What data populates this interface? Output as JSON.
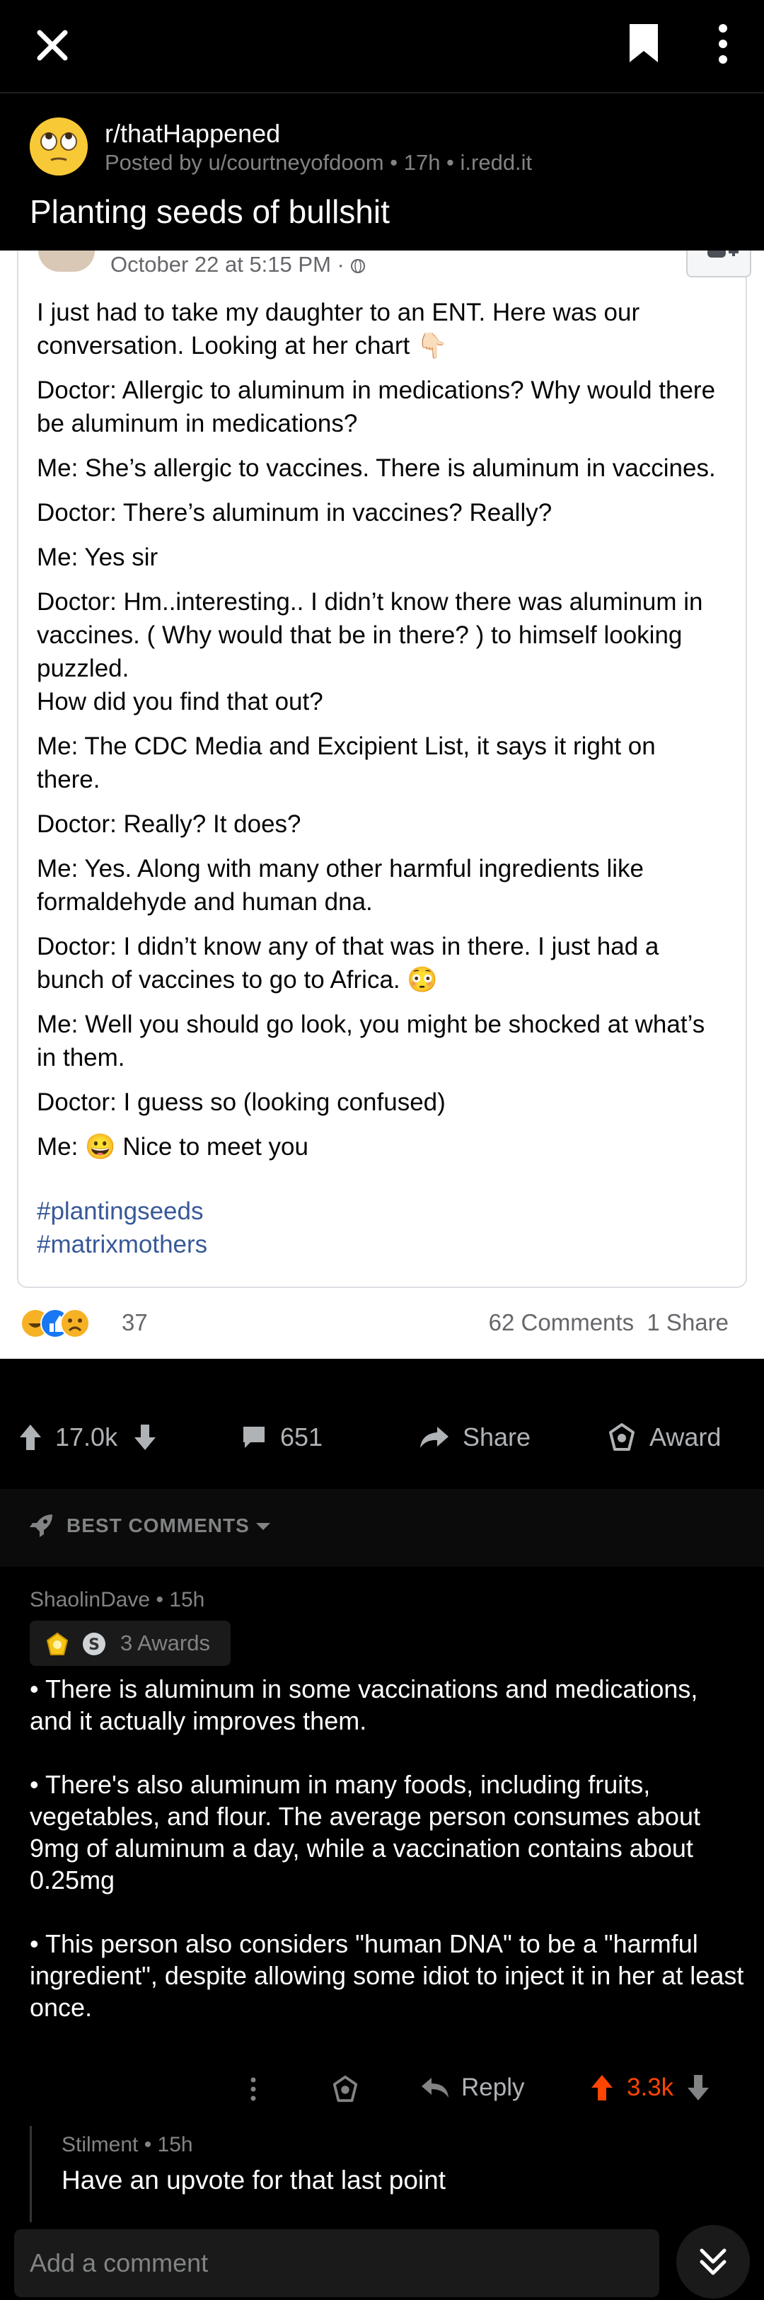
{
  "topbar": {
    "close_icon": "close-icon",
    "save_icon": "bookmark-icon",
    "more_icon": "kebab-menu-icon"
  },
  "post": {
    "subreddit": "r/thatHappened",
    "meta": "Posted by u/courtneyofdoom • 17h • i.redd.it",
    "title": "Planting seeds of bullshit"
  },
  "screenshot": {
    "timestamp": "October 22 at 5:15 PM · ",
    "lines": [
      "I just had to take my daughter to an ENT. Here was our conversation. Looking at her chart 👇🏻",
      "Doctor: Allergic to aluminum in medications? Why would there be aluminum in medications?",
      "Me: She’s allergic to vaccines. There is aluminum in vaccines.",
      "Doctor: There’s aluminum in vaccines? Really?",
      "Me: Yes sir",
      "Doctor: Hm..interesting.. I didn’t know there was aluminum in vaccines. ( Why would that be in there? ) to himself looking puzzled.\nHow did you find that out?",
      "Me: The CDC Media and Excipient List, it says it right on there.",
      "Doctor: Really? It does?",
      "Me: Yes. Along with many other harmful ingredients like formaldehyde and human dna.",
      "Doctor: I didn’t know any of that was in there. I just had a bunch of vaccines to go to Africa. 😳",
      "Me: Well you should go look, you might be shocked at what’s in them.",
      "Doctor: I guess so (looking confused)",
      "Me: 😀 Nice to meet you"
    ],
    "tags": [
      "#plantingseeds",
      "#matrixmothers"
    ],
    "reaction_count": "37",
    "comments_shares": "62 Comments  1 Share"
  },
  "actions": {
    "votes": "17.0k",
    "comments": "651",
    "share": "Share",
    "award": "Award"
  },
  "sort": {
    "label": "BEST COMMENTS"
  },
  "comment": {
    "author": "ShaolinDave • 15h",
    "awards": "3 Awards",
    "paragraphs": [
      "• There is aluminum in some vaccinations and medications, and it actually improves them.",
      "• There's also aluminum in many foods, including fruits, vegetables, and flour. The average person consumes about 9mg of aluminum a day, while a vaccination contains about 0.25mg",
      "• This person also considers \"human DNA\" to be a \"harmful ingredient\", despite allowing some idiot to inject it in her at least once."
    ],
    "reply_label": "Reply",
    "score": "3.3k"
  },
  "reply": {
    "author": "Stilment • 15h",
    "body": "Have an upvote for that last point"
  },
  "bottom": {
    "placeholder": "Add a comment"
  },
  "colors": {
    "upvote": "#ff4500",
    "fb_link": "#385898",
    "background": "#000000"
  }
}
